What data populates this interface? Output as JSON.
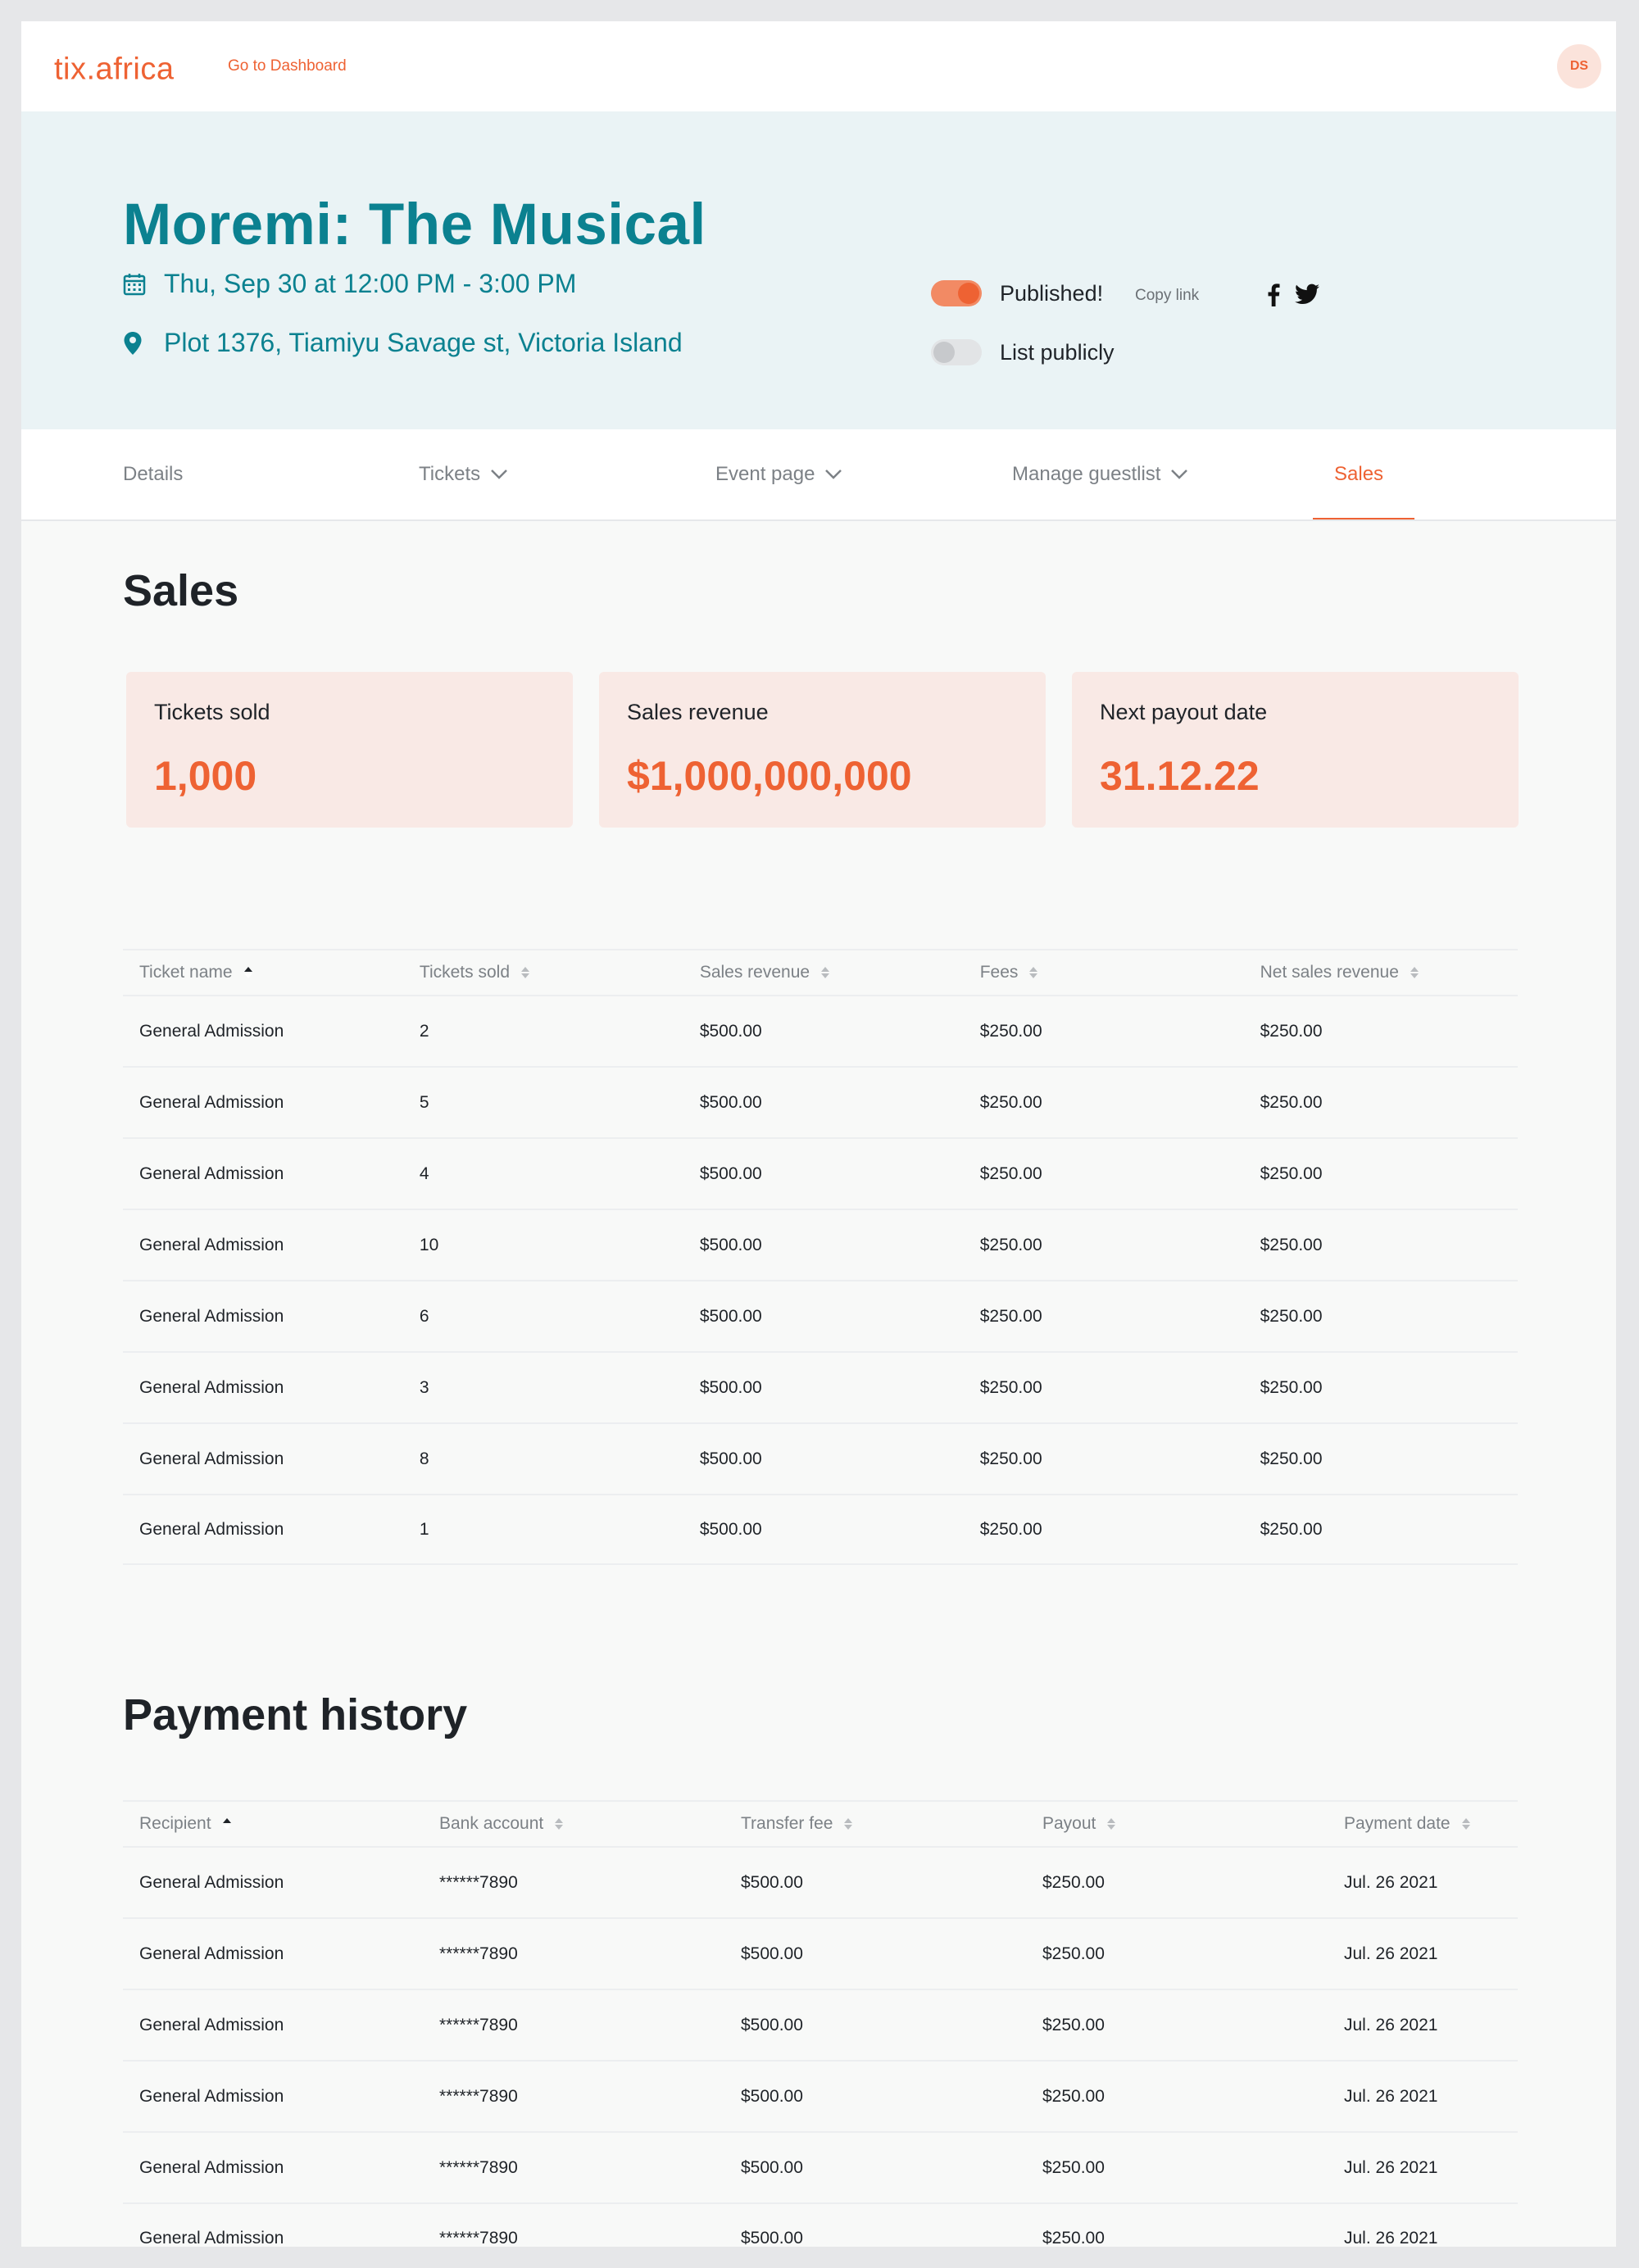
{
  "header": {
    "logo": "tix.africa",
    "dashboard_link": "Go to Dashboard",
    "avatar_initials": "DS"
  },
  "event": {
    "title": "Moremi: The Musical",
    "date": "Thu, Sep 30 at 12:00 PM - 3:00 PM",
    "location": "Plot 1376, Tiamiyu Savage st, Victoria Island",
    "published_label": "Published!",
    "published_on": true,
    "copy_link_label": "Copy link",
    "list_publicly_label": "List publicly",
    "list_publicly_on": false
  },
  "tabs": [
    {
      "label": "Details",
      "has_dropdown": false,
      "active": false
    },
    {
      "label": "Tickets",
      "has_dropdown": true,
      "active": false
    },
    {
      "label": "Event page",
      "has_dropdown": true,
      "active": false
    },
    {
      "label": "Manage guestlist",
      "has_dropdown": true,
      "active": false
    },
    {
      "label": "Sales",
      "has_dropdown": false,
      "active": true
    }
  ],
  "sales": {
    "title": "Sales",
    "cards": [
      {
        "label": "Tickets sold",
        "value": "1,000"
      },
      {
        "label": "Sales revenue",
        "value": "$1,000,000,000"
      },
      {
        "label": "Next payout date",
        "value": "31.12.22"
      }
    ],
    "table": {
      "columns": [
        "Ticket name",
        "Tickets sold",
        "Sales revenue",
        "Fees",
        "Net sales revenue"
      ],
      "sorted_column": 0,
      "rows": [
        [
          "General Admission",
          "2",
          "$500.00",
          "$250.00",
          "$250.00"
        ],
        [
          "General Admission",
          "5",
          "$500.00",
          "$250.00",
          "$250.00"
        ],
        [
          "General Admission",
          "4",
          "$500.00",
          "$250.00",
          "$250.00"
        ],
        [
          "General Admission",
          "10",
          "$500.00",
          "$250.00",
          "$250.00"
        ],
        [
          "General Admission",
          "6",
          "$500.00",
          "$250.00",
          "$250.00"
        ],
        [
          "General Admission",
          "3",
          "$500.00",
          "$250.00",
          "$250.00"
        ],
        [
          "General Admission",
          "8",
          "$500.00",
          "$250.00",
          "$250.00"
        ],
        [
          "General Admission",
          "1",
          "$500.00",
          "$250.00",
          "$250.00"
        ]
      ]
    }
  },
  "payments": {
    "title": "Payment history",
    "table": {
      "columns": [
        "Recipient",
        "Bank account",
        "Transfer fee",
        "Payout",
        "Payment date"
      ],
      "sorted_column": 0,
      "rows": [
        [
          "General Admission",
          "******7890",
          "$500.00",
          "$250.00",
          "Jul. 26 2021"
        ],
        [
          "General Admission",
          "******7890",
          "$500.00",
          "$250.00",
          "Jul. 26 2021"
        ],
        [
          "General Admission",
          "******7890",
          "$500.00",
          "$250.00",
          "Jul. 26 2021"
        ],
        [
          "General Admission",
          "******7890",
          "$500.00",
          "$250.00",
          "Jul. 26 2021"
        ],
        [
          "General Admission",
          "******7890",
          "$500.00",
          "$250.00",
          "Jul. 26 2021"
        ],
        [
          "General Admission",
          "******7890",
          "$500.00",
          "$250.00",
          "Jul. 26 2021"
        ]
      ]
    }
  },
  "colors": {
    "brand": "#ee6233",
    "teal": "#0b8190",
    "hero_bg": "#eaf3f5",
    "card_bg": "#f9e9e5"
  },
  "icons": [
    "calendar-icon",
    "location-pin-icon",
    "facebook-icon",
    "twitter-icon",
    "chevron-down-icon",
    "sort-icon"
  ]
}
